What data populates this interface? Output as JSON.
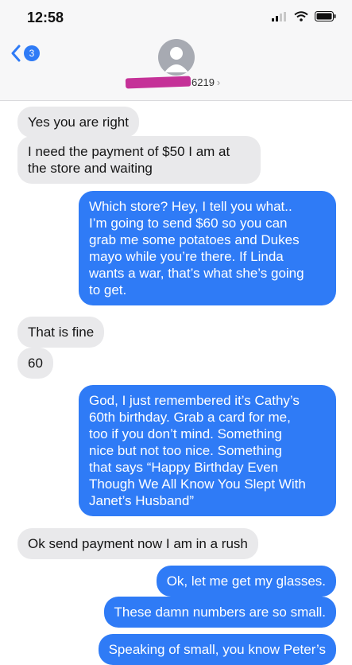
{
  "status_bar": {
    "time": "12:58"
  },
  "header": {
    "back_badge": "3",
    "contact_number_suffix": "6219"
  },
  "messages": [
    {
      "from": "them",
      "text": "Yes you are right"
    },
    {
      "from": "them",
      "text": "I need the payment of $50 I am at\nthe store and waiting"
    },
    {
      "from": "me",
      "text": "Which store? Hey, I tell you what..\nI’m going to send $60 so you can\ngrab me some potatoes and Dukes\nmayo while you’re there. If Linda\nwants a war, that’s what she’s going\nto get."
    },
    {
      "from": "them",
      "text": "That is fine"
    },
    {
      "from": "them",
      "text": "60"
    },
    {
      "from": "me",
      "text": "God, I just remembered it’s Cathy’s\n60th birthday. Grab a card for me,\ntoo if you don’t mind. Something\nnice but not too nice. Something\nthat says “Happy Birthday Even\nThough We All Know You Slept With\nJanet’s Husband”"
    },
    {
      "from": "them",
      "text": "Ok send payment now I am in a rush"
    },
    {
      "from": "me",
      "text": "Ok, let me get my glasses."
    },
    {
      "from": "me",
      "text": "These damn numbers are so small."
    },
    {
      "from": "me",
      "text": "Speaking of small, you know Peter’s"
    }
  ],
  "colors": {
    "sent_bubble": "#2f7bf6",
    "received_bubble": "#e9e9eb",
    "redaction_mark": "#c0208f"
  }
}
